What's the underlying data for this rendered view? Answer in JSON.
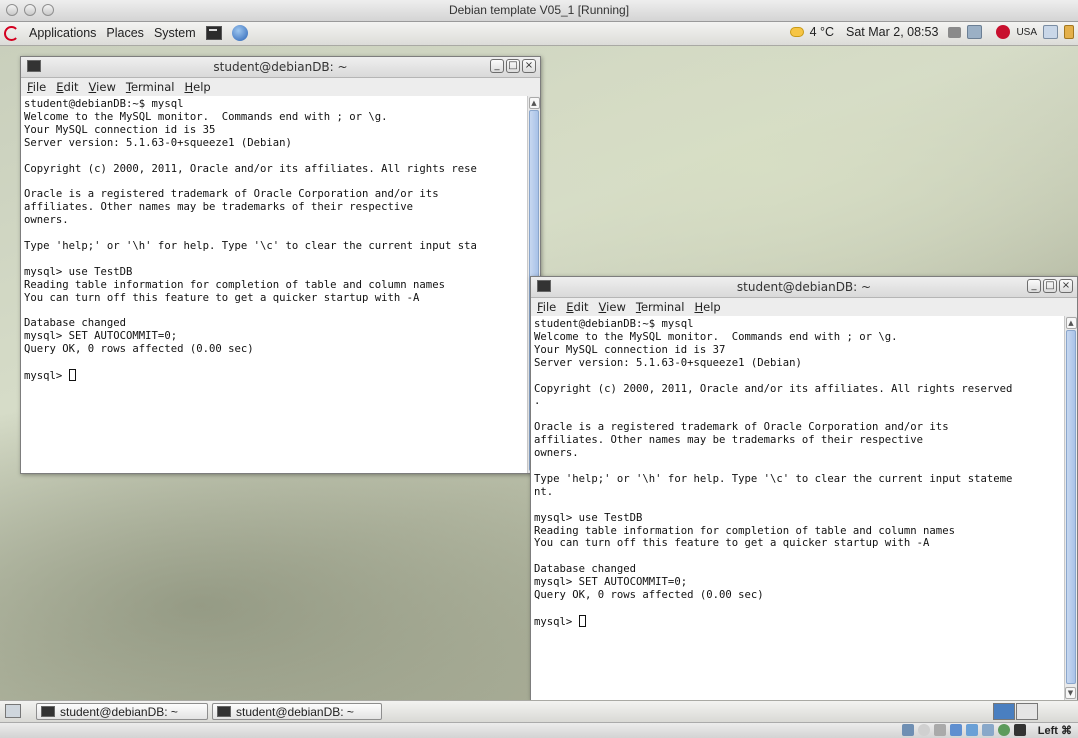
{
  "host_window": {
    "title": "Debian template V05_1 [Running]"
  },
  "top_panel": {
    "menus": [
      "Applications",
      "Places",
      "System"
    ],
    "weather": "4 °C",
    "clock": "Sat Mar 2, 08:53",
    "keyboard_layout": "USA"
  },
  "terminal_1": {
    "title": "student@debianDB: ~",
    "menu": [
      "File",
      "Edit",
      "View",
      "Terminal",
      "Help"
    ],
    "lines": [
      "student@debianDB:~$ mysql",
      "Welcome to the MySQL monitor.  Commands end with ; or \\g.",
      "Your MySQL connection id is 35",
      "Server version: 5.1.63-0+squeeze1 (Debian)",
      "",
      "Copyright (c) 2000, 2011, Oracle and/or its affiliates. All rights rese",
      "",
      "Oracle is a registered trademark of Oracle Corporation and/or its",
      "affiliates. Other names may be trademarks of their respective",
      "owners.",
      "",
      "Type 'help;' or '\\h' for help. Type '\\c' to clear the current input sta",
      "",
      "mysql> use TestDB",
      "Reading table information for completion of table and column names",
      "You can turn off this feature to get a quicker startup with -A",
      "",
      "Database changed",
      "mysql> SET AUTOCOMMIT=0;",
      "Query OK, 0 rows affected (0.00 sec)",
      ""
    ],
    "prompt": "mysql> "
  },
  "terminal_2": {
    "title": "student@debianDB: ~",
    "menu": [
      "File",
      "Edit",
      "View",
      "Terminal",
      "Help"
    ],
    "lines": [
      "student@debianDB:~$ mysql",
      "Welcome to the MySQL monitor.  Commands end with ; or \\g.",
      "Your MySQL connection id is 37",
      "Server version: 5.1.63-0+squeeze1 (Debian)",
      "",
      "Copyright (c) 2000, 2011, Oracle and/or its affiliates. All rights reserved",
      ".",
      "",
      "Oracle is a registered trademark of Oracle Corporation and/or its",
      "affiliates. Other names may be trademarks of their respective",
      "owners.",
      "",
      "Type 'help;' or '\\h' for help. Type '\\c' to clear the current input stateme",
      "nt.",
      "",
      "mysql> use TestDB",
      "Reading table information for completion of table and column names",
      "You can turn off this feature to get a quicker startup with -A",
      "",
      "Database changed",
      "mysql> SET AUTOCOMMIT=0;",
      "Query OK, 0 rows affected (0.00 sec)",
      ""
    ],
    "prompt": "mysql> "
  },
  "taskbar": {
    "tasks": [
      "student@debianDB: ~",
      "student@debianDB: ~"
    ]
  },
  "vbox_status": {
    "host_key": "Left ⌘"
  },
  "colors": {
    "selection_blue": "#4a7fc0",
    "debian_red": "#d40020"
  }
}
